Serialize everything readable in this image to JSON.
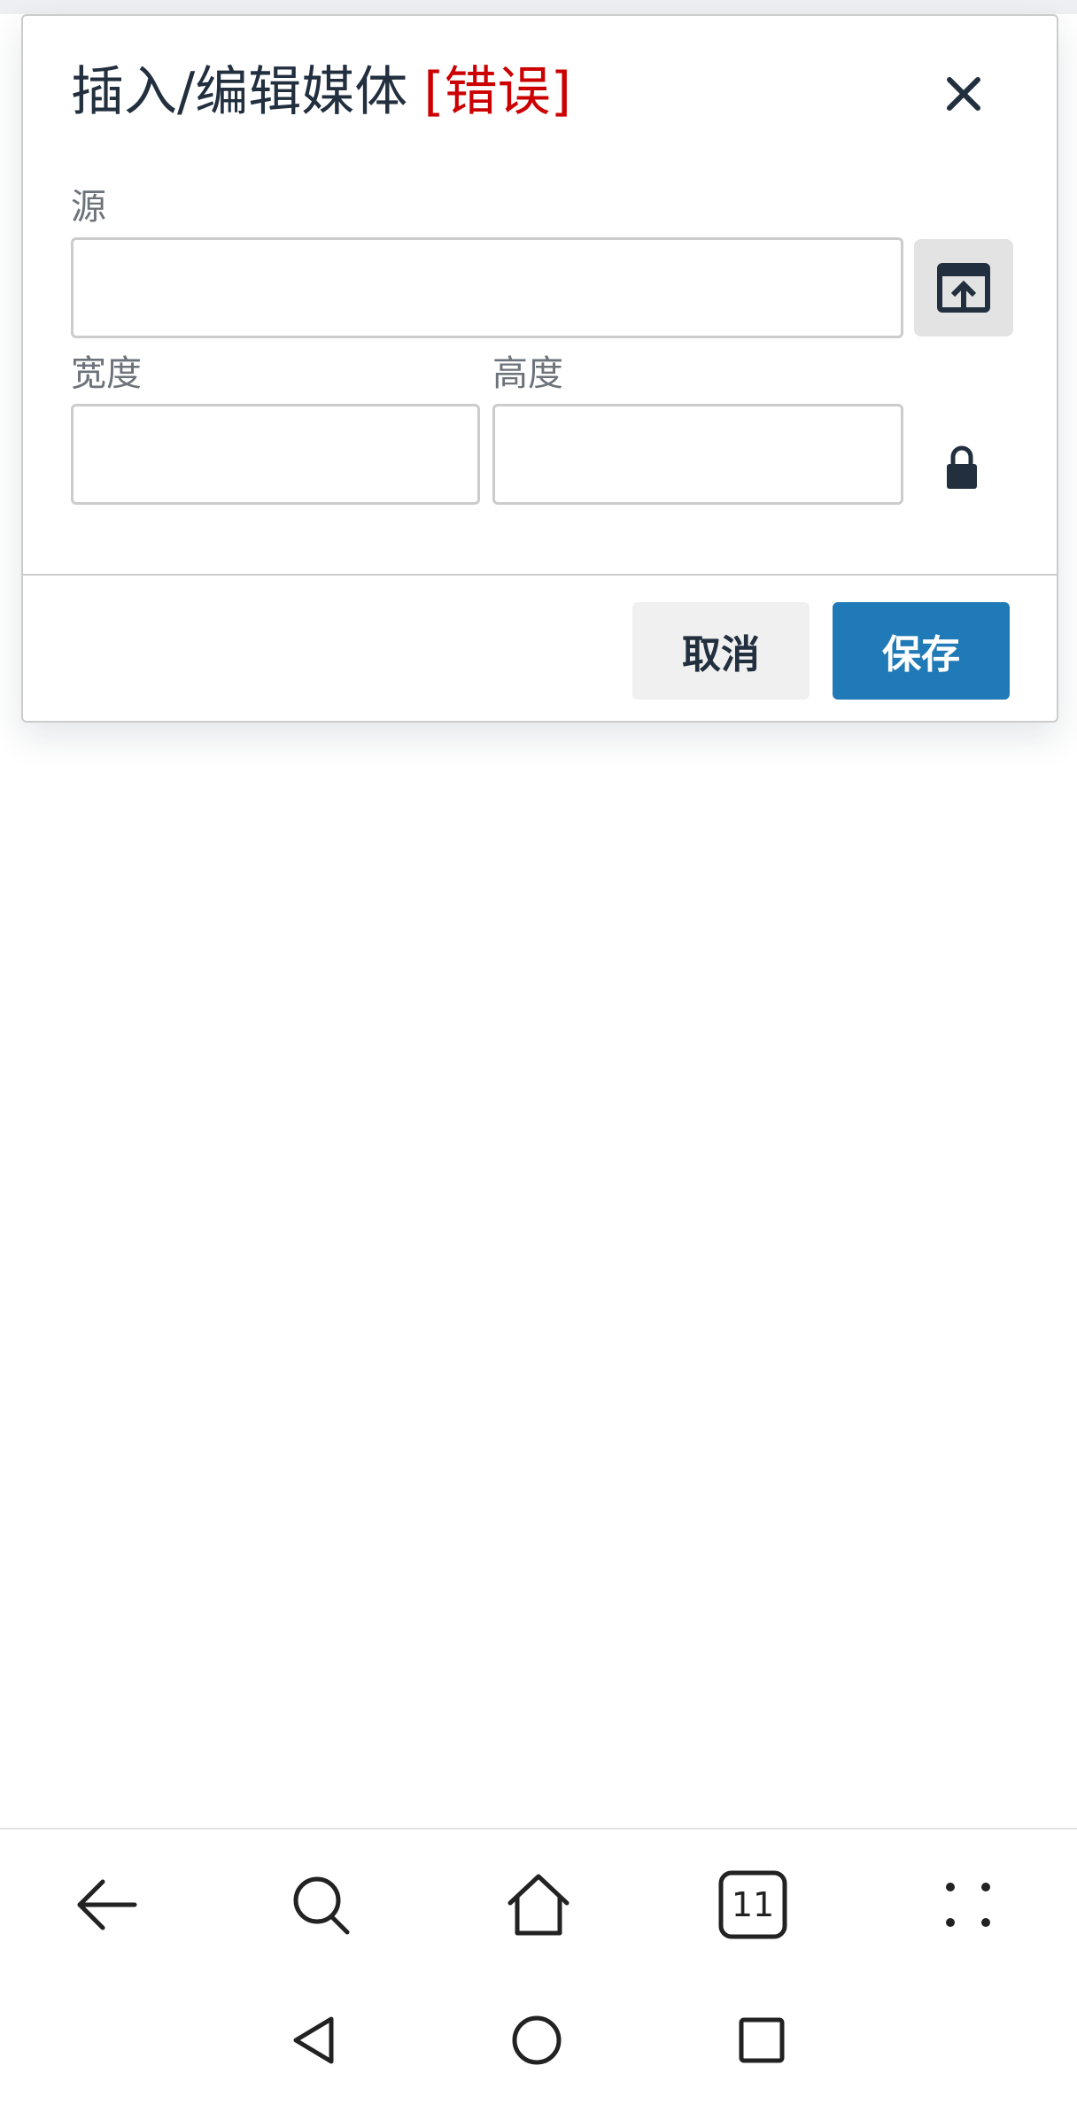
{
  "dialog": {
    "title": "插入/编辑媒体",
    "title_error": "[错误]",
    "close_icon": "close-icon",
    "source_label": "源",
    "source_value": "",
    "browse_icon": "upload-icon",
    "width_label": "宽度",
    "width_value": "",
    "height_label": "高度",
    "height_value": "",
    "lock_icon": "lock-icon",
    "cancel_label": "取消",
    "save_label": "保存"
  },
  "browser_nav": {
    "back_icon": "back-arrow-icon",
    "search_icon": "search-icon",
    "home_icon": "home-icon",
    "tabs_count": "11",
    "menu_icon": "more-dots-icon"
  },
  "system_nav": {
    "back_icon": "triangle-back-icon",
    "home_icon": "circle-home-icon",
    "recents_icon": "square-recents-icon"
  },
  "colors": {
    "text": "#222f3e",
    "error": "#cc0000",
    "primary_button": "#207ab7",
    "secondary_button": "#f0f0f0",
    "border": "#cccccc"
  }
}
